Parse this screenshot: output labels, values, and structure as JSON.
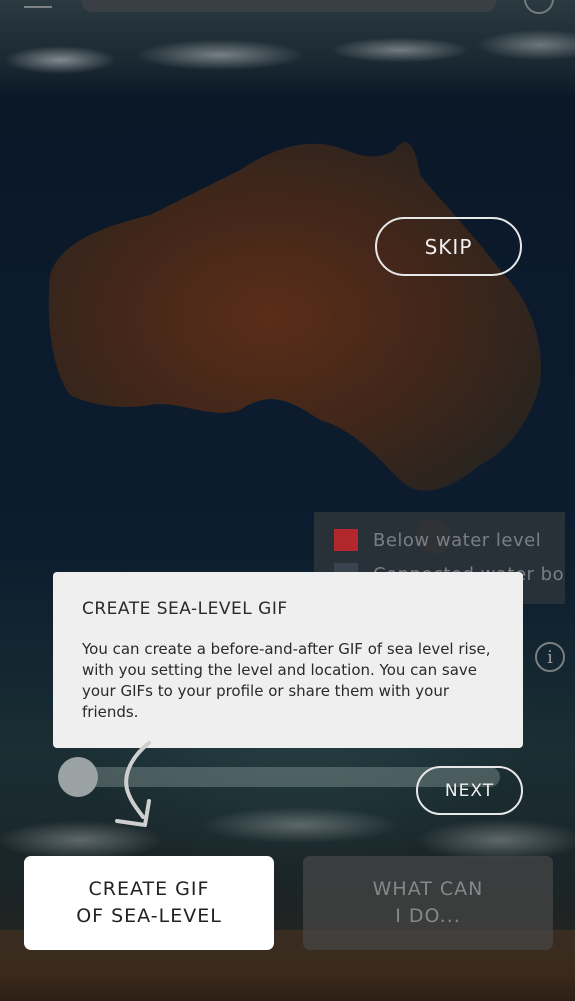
{
  "onboarding": {
    "skip_label": "SKIP",
    "next_label": "NEXT",
    "tip": {
      "title": "CREATE SEA-LEVEL GIF",
      "body": "You can create a before-and-after GIF of sea level rise, with you setting the level and location. You can save your GIFs to your profile or share them with your friends."
    }
  },
  "legend": {
    "items": [
      {
        "label": "Below water level",
        "color": "#b3282c"
      },
      {
        "label": "Connected water body",
        "color": "#3a4450"
      }
    ]
  },
  "slider": {
    "level": 0
  },
  "actions": {
    "create_gif_label": "CREATE GIF\nOF SEA-LEVEL",
    "what_can_label": "WHAT CAN\nI DO..."
  },
  "icons": {
    "info": "info-icon",
    "arrow": "curved-down-arrow-icon"
  }
}
